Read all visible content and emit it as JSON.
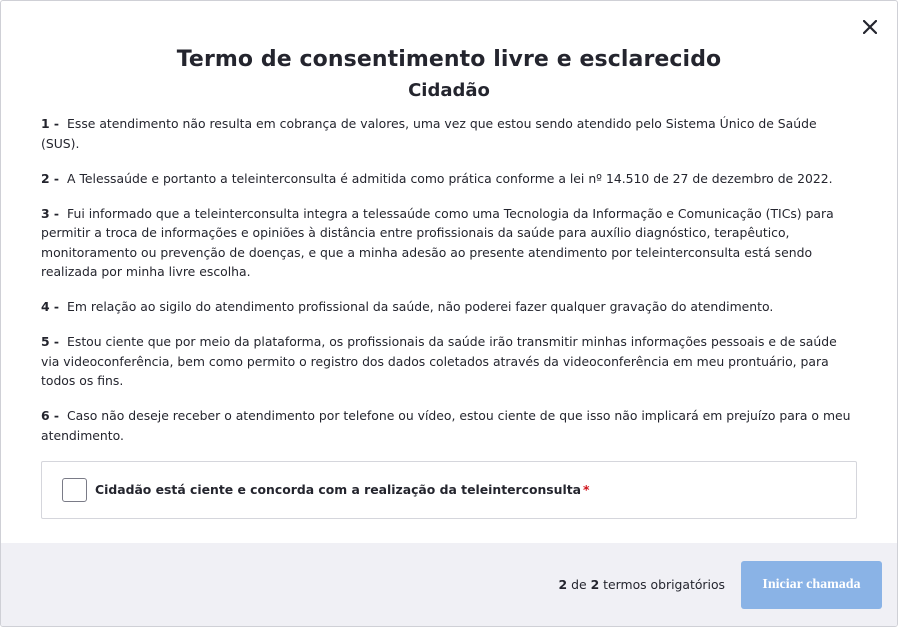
{
  "modal": {
    "title": "Termo de consentimento livre e esclarecido",
    "subtitle": "Cidadão",
    "close_icon": "close-icon"
  },
  "terms": [
    {
      "number": "1 -",
      "text": "Esse atendimento não resulta em cobrança de valores, uma vez que estou sendo atendido pelo Sistema Único de Saúde (SUS)."
    },
    {
      "number": "2 -",
      "text": "A Telessaúde e portanto a teleinterconsulta é admitida como prática conforme a lei nº 14.510 de 27 de dezembro de 2022."
    },
    {
      "number": "3 -",
      "text": "Fui informado que a teleinterconsulta integra a telessaúde como uma Tecnologia da Informação e Comunicação (TICs) para permitir a troca de informações e opiniões à distância entre profissionais da saúde para auxílio diagnóstico, terapêutico, monitoramento ou prevenção de doenças, e que a minha adesão ao presente atendimento por teleinterconsulta está sendo realizada por minha livre escolha."
    },
    {
      "number": "4 -",
      "text": "Em relação ao sigilo do atendimento profissional da saúde, não poderei fazer qualquer gravação do atendimento."
    },
    {
      "number": "5 -",
      "text": "Estou ciente que por meio da plataforma, os profissionais da saúde irão transmitir minhas informações pessoais e de saúde via videoconferência, bem como permito o registro dos dados coletados através da videoconferência em meu prontuário, para todos os fins."
    },
    {
      "number": "6 -",
      "text": "Caso não deseje receber o atendimento por telefone ou vídeo, estou ciente de que isso não implicará em prejuízo para o meu atendimento."
    }
  ],
  "consent": {
    "label": "Cidadão está ciente e concorda com a realização da teleinterconsulta",
    "required_mark": "*",
    "checked": false
  },
  "footer": {
    "accepted_count": "2",
    "of_label": "de",
    "total_count": "2",
    "suffix_label": "termos obrigatórios",
    "start_button_label": "Iniciar chamada"
  },
  "colors": {
    "primary_disabled": "#8ab3e6",
    "required": "#d0121a",
    "footer_bg": "#f0f0f5"
  }
}
